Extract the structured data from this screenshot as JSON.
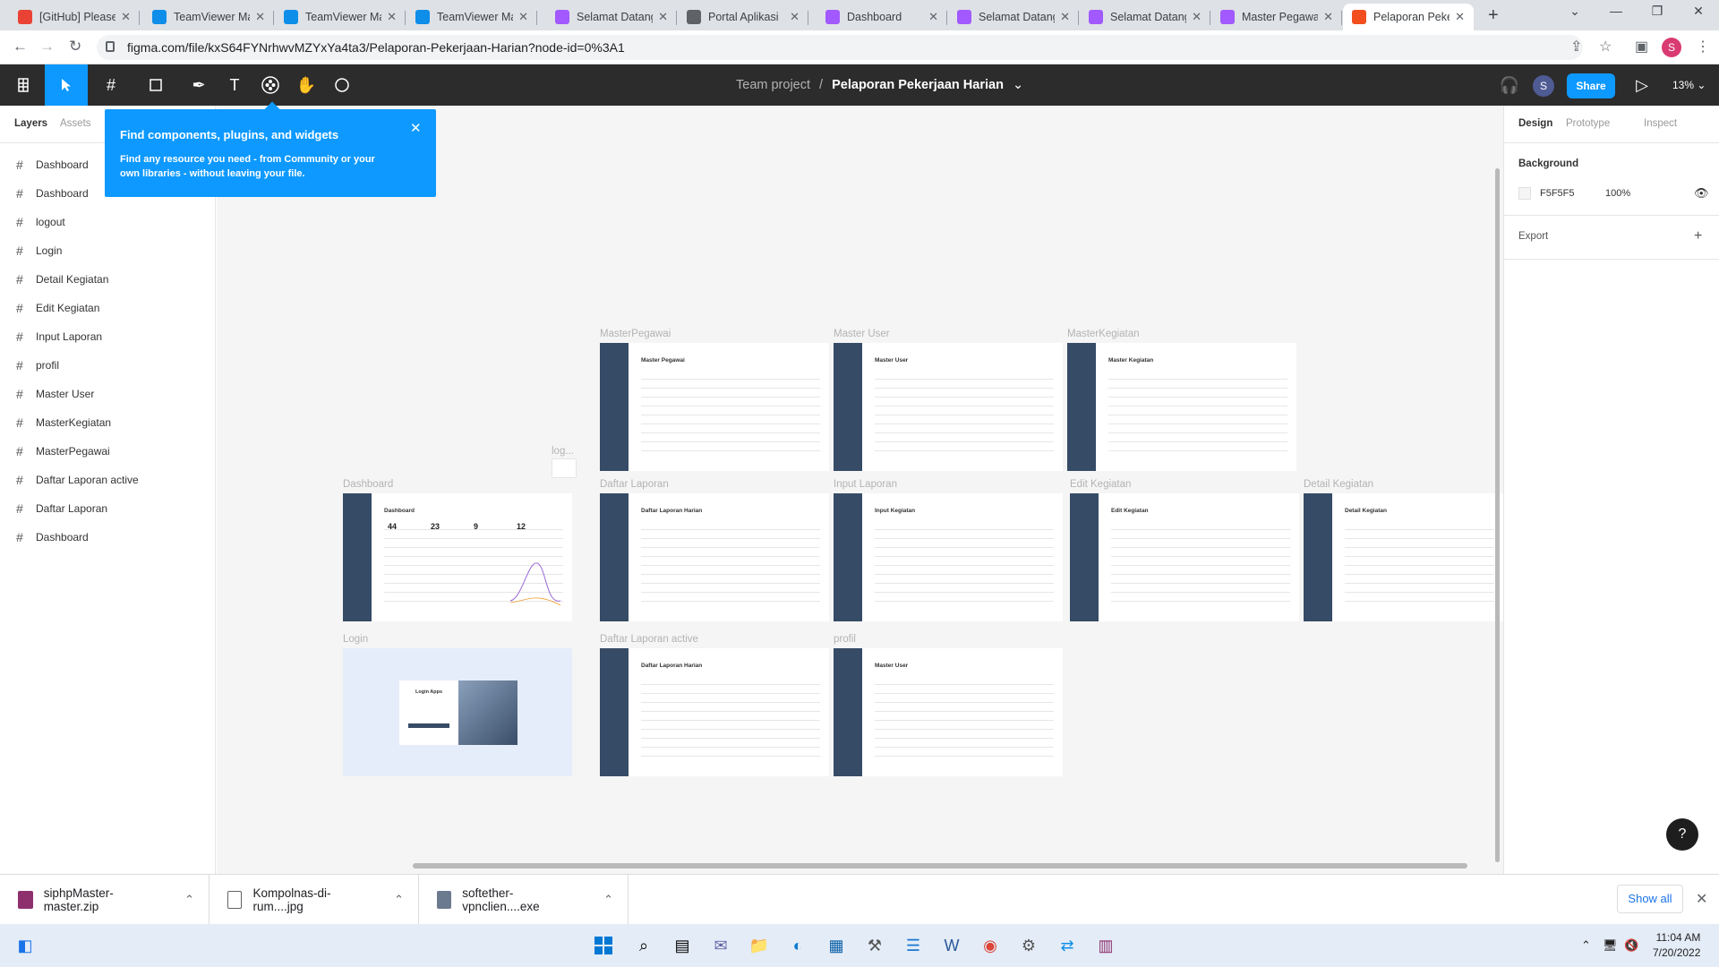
{
  "browser": {
    "tabs": [
      {
        "title": "[GitHub] Please",
        "icon": "gmail-icon",
        "color": "#ea4335"
      },
      {
        "title": "TeamViewer Ma",
        "icon": "teamviewer-icon",
        "color": "#0e8ee9"
      },
      {
        "title": "TeamViewer Ma",
        "icon": "teamviewer-icon",
        "color": "#0e8ee9"
      },
      {
        "title": "TeamViewer Ma",
        "icon": "teamviewer-icon",
        "color": "#0e8ee9"
      },
      {
        "title": "Selamat Datang",
        "icon": "figma-icon",
        "color": "#a259ff"
      },
      {
        "title": "Portal Aplikasi",
        "icon": "globe-icon",
        "color": "#5f6368"
      },
      {
        "title": "Dashboard",
        "icon": "figma-icon",
        "color": "#a259ff"
      },
      {
        "title": "Selamat Datang",
        "icon": "figma-icon",
        "color": "#a259ff"
      },
      {
        "title": "Selamat Datang",
        "icon": "figma-icon",
        "color": "#a259ff"
      },
      {
        "title": "Master Pegawai",
        "icon": "figma-icon",
        "color": "#a259ff"
      },
      {
        "title": "Pelaporan Peker",
        "icon": "figma-icon",
        "color": "#f24e1e"
      }
    ],
    "url": "figma.com/file/kxS64FYNrhwvMZYxYa4ta3/Pelaporan-Pekerjaan-Harian?node-id=0%3A1",
    "profile_initial": "S"
  },
  "figma": {
    "project": "Team project",
    "file_title": "Pelaporan Pekerjaan Harian",
    "avatar_initial": "S",
    "share_label": "Share",
    "zoom": "13%",
    "left_tabs": [
      "Layers",
      "Assets"
    ],
    "layers": [
      "Dashboard",
      "Dashboard",
      "logout",
      "Login",
      "Detail Kegiatan",
      "Edit Kegiatan",
      "Input Laporan",
      "profil",
      "Master User",
      "MasterKegiatan",
      "MasterPegawai",
      "Daftar Laporan active",
      "Daftar Laporan",
      "Dashboard"
    ],
    "right_tabs": [
      "Design",
      "Prototype",
      "Inspect"
    ],
    "background_label": "Background",
    "background_hex": "F5F5F5",
    "background_opacity": "100%",
    "export_label": "Export",
    "tooltip": {
      "title": "Find components, plugins, and widgets",
      "body": "Find any resource you need - from Community or your own libraries - without leaving your file."
    },
    "frames": [
      {
        "label": "MasterPegawai",
        "heading": "Master Pegawai"
      },
      {
        "label": "Master User",
        "heading": "Master User"
      },
      {
        "label": "MasterKegiatan",
        "heading": "Master Kegiatan"
      },
      {
        "label": "Dashboard",
        "heading": "Dashboard"
      },
      {
        "label": "Daftar Laporan",
        "heading": "Daftar Laporan Harian"
      },
      {
        "label": "Input Laporan",
        "heading": "Input Kegiatan"
      },
      {
        "label": "Edit Kegiatan",
        "heading": "Edit Kegiatan"
      },
      {
        "label": "Detail Kegiatan",
        "heading": "Detail Kegiatan"
      },
      {
        "label": "Login",
        "heading": "Login Apps"
      },
      {
        "label": "Daftar Laporan active",
        "heading": "Daftar Laporan Harian"
      },
      {
        "label": "profil",
        "heading": "Master User"
      }
    ],
    "logout_label": "log...",
    "dashboard_stats": [
      "44",
      "23",
      "9",
      "12"
    ]
  },
  "downloads": {
    "items": [
      "siphpMaster-master.zip",
      "Kompolnas-di-rum....jpg",
      "softether-vpnclien....exe"
    ],
    "show_all": "Show all"
  },
  "clock": {
    "time": "11:04 AM",
    "date": "7/20/2022"
  }
}
